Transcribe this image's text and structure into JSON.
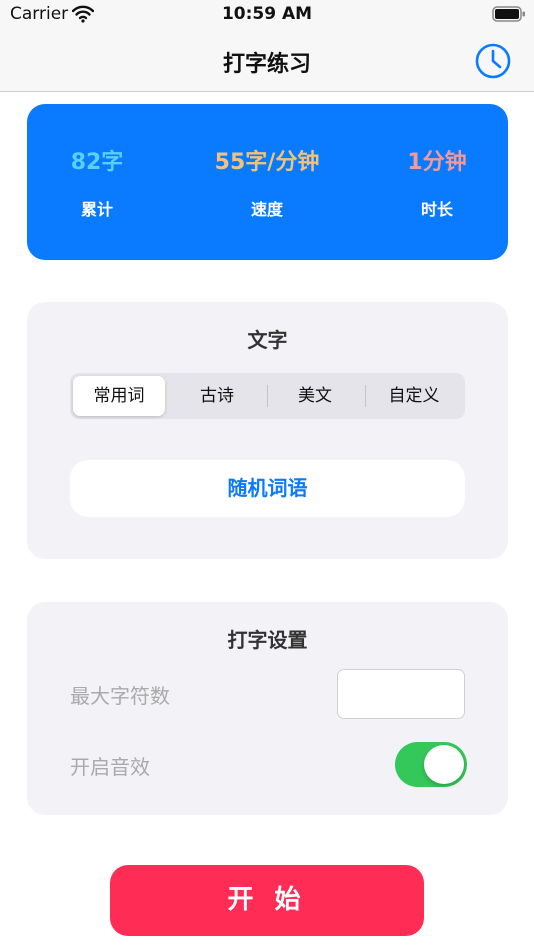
{
  "status_bar": {
    "carrier": "Carrier",
    "time": "10:59 AM"
  },
  "nav": {
    "title": "打字练习",
    "history_icon": "clock-icon"
  },
  "stats": [
    {
      "value": "82字",
      "label": "累计",
      "color": "#5ad0f5"
    },
    {
      "value": "55字/分钟",
      "label": "速度",
      "color": "#f2c27a"
    },
    {
      "value": "1分钟",
      "label": "时长",
      "color": "#f29a9a"
    }
  ],
  "text_section": {
    "title": "文字",
    "segments": [
      "常用词",
      "古诗",
      "美文",
      "自定义"
    ],
    "selected_segment": "常用词",
    "random_button": "随机词语"
  },
  "typing_settings": {
    "title": "打字设置",
    "max_chars_label": "最大字符数",
    "max_chars_value": "",
    "sound_label": "开启音效",
    "sound_enabled": true
  },
  "start_button": "开 始",
  "colors": {
    "accent": "#0a7aff",
    "start": "#ff2d55",
    "toggle_on": "#34c759"
  }
}
